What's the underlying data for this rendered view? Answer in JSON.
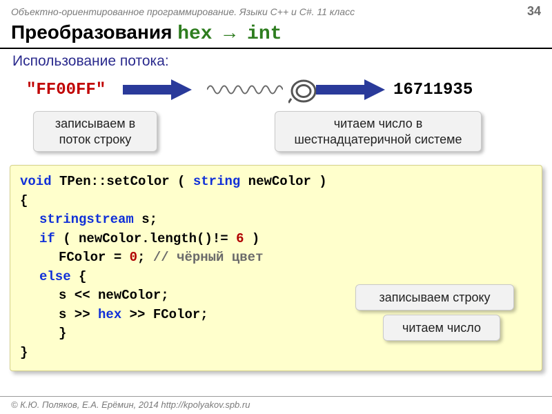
{
  "header": {
    "course": "Объектно-ориентированное программирование. Языки C++ и C#. 11 класс",
    "page_number": "34"
  },
  "title": {
    "prefix": "Преобразования ",
    "code": "hex → int"
  },
  "subtitle": "Использование потока:",
  "diagram": {
    "hex_literal": "\"FF00FF\"",
    "dec_result": "16711935",
    "tag_write": "записываем в поток строку",
    "tag_read_hex": "читаем число в шестнадцатеричной системе"
  },
  "code": {
    "l1_kw_void": "void",
    "l1_cls": " TPen::setColor",
    "l1_paren_open": " ( ",
    "l1_kw_string": "string",
    "l1_param": " newColor )",
    "l2": "{",
    "l3_type": "stringstream",
    "l3_rest": " s;",
    "l4_kw_if": "if",
    "l4_cond": " ( newColor.length()!= ",
    "l4_num": "6",
    "l4_close": " )",
    "l5_lhs": "FColor = ",
    "l5_num": "0",
    "l5_semi": ";",
    "l5_cmt": "   // чёрный цвет",
    "l6_kw_else": "else",
    "l6_brace": " {",
    "l7": "s << newColor;",
    "l8_a": "s >> ",
    "l8_hex": "hex",
    "l8_b": " >> FColor;",
    "l9": "}",
    "l10": "}"
  },
  "overlays": {
    "write_string": "записываем строку",
    "read_number": "читаем число"
  },
  "footer": {
    "text": "© К.Ю. Поляков, Е.А. Ерёмин, 2014    http://kpolyakov.spb.ru"
  }
}
